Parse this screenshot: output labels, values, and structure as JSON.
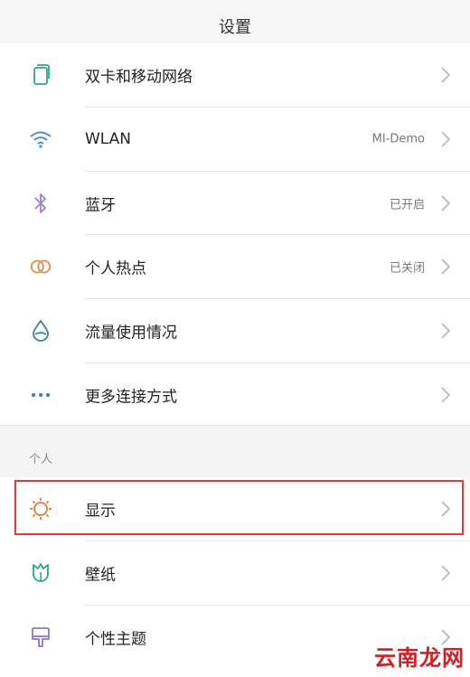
{
  "header": {
    "title": "设置"
  },
  "network": [
    {
      "label": "双卡和移动网络",
      "value": "",
      "icon": "sim-card-icon"
    },
    {
      "label": "WLAN",
      "value": "MI-Demo",
      "icon": "wifi-icon"
    },
    {
      "label": "蓝牙",
      "value": "已开启",
      "icon": "bluetooth-icon"
    },
    {
      "label": "个人热点",
      "value": "已关闭",
      "icon": "hotspot-icon"
    },
    {
      "label": "流量使用情况",
      "value": "",
      "icon": "data-usage-icon"
    },
    {
      "label": "更多连接方式",
      "value": "",
      "icon": "more-connections-icon"
    }
  ],
  "personal": {
    "section_title": "个人",
    "items": [
      {
        "label": "显示",
        "value": "",
        "icon": "display-brightness-icon"
      },
      {
        "label": "壁纸",
        "value": "",
        "icon": "wallpaper-icon"
      },
      {
        "label": "个性主题",
        "value": "",
        "icon": "theme-icon"
      }
    ]
  },
  "watermark": "云南龙网",
  "colors": {
    "wifi": "#4a90c8",
    "bluetooth": "#9b7fd0",
    "hotspot": "#e0904a",
    "data": "#3a7fa8",
    "display": "#e07a3a",
    "wallpaper": "#2ea889",
    "theme": "#8d74c8",
    "highlight": "#e8383b"
  }
}
